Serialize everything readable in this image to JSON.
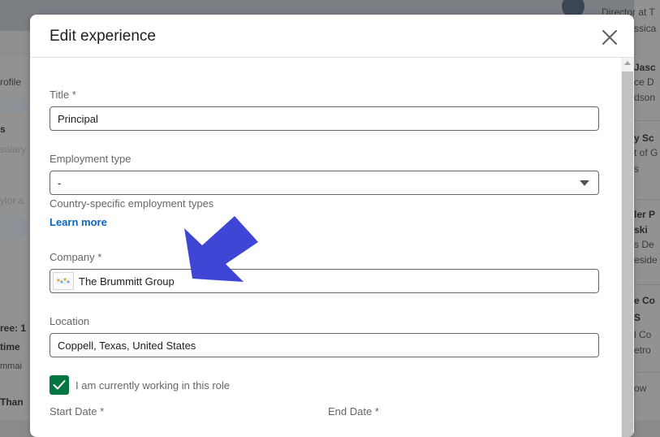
{
  "modal": {
    "title": "Edit experience"
  },
  "form": {
    "title_label": "Title *",
    "title_value": "Principal",
    "employment_type_label": "Employment type",
    "employment_type_value": "-",
    "employment_helper": "Country-specific employment types",
    "learn_more": "Learn more",
    "company_label": "Company *",
    "company_value": "The Brummitt Group",
    "location_label": "Location",
    "location_value": "Coppell, Texas, United States",
    "currently_working_label": "I am currently working in this role",
    "currently_working_checked": true,
    "start_date_label": "Start Date *",
    "end_date_label": "End Date *"
  },
  "background": {
    "left_fragments": [
      "rofile",
      "s",
      "salary",
      "ylor a",
      "ree: 1",
      "time",
      "mmai",
      "Than"
    ],
    "right_fragments": [
      "Director at T",
      "ssica",
      "Jasc",
      "ce D",
      "dson",
      "y Sc",
      "t of G",
      "s",
      "ler P",
      "ski",
      "s De",
      "eside",
      "e Co",
      "S",
      "l Co",
      "etro",
      "ow"
    ]
  },
  "colors": {
    "accent": "#0a66c2",
    "checkbox": "#057642",
    "annotation_arrow": "#3f45d4"
  }
}
